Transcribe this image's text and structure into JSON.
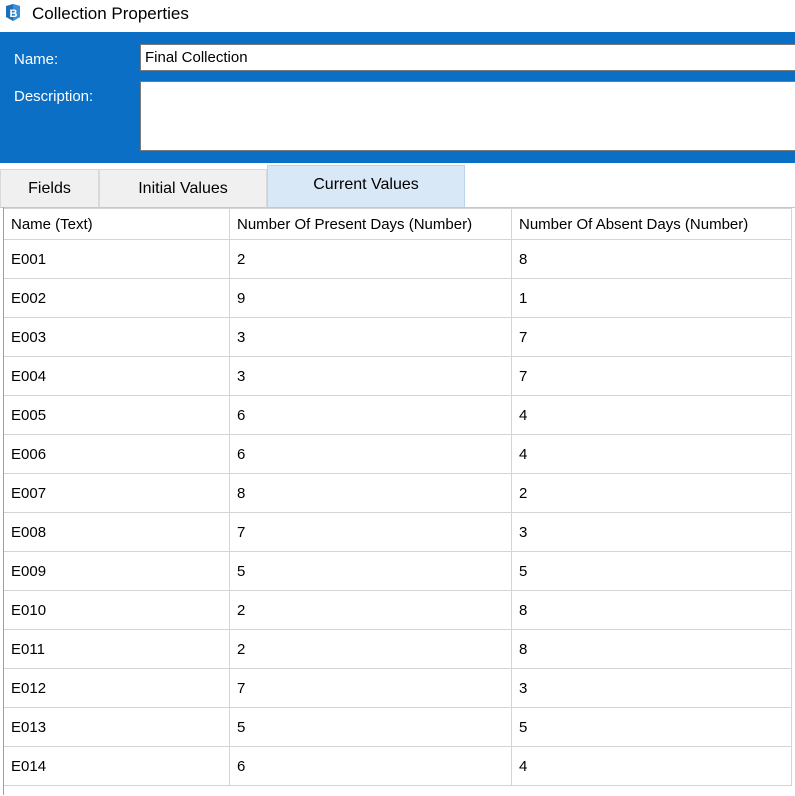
{
  "window": {
    "title": "Collection Properties",
    "icon": "blueprism-icon",
    "accent_color": "#0b6fc6"
  },
  "form": {
    "name_label": "Name:",
    "name_value": "Final Collection",
    "description_label": "Description:",
    "description_value": ""
  },
  "tabs": [
    {
      "label": "Fields",
      "active": false
    },
    {
      "label": "Initial Values",
      "active": false
    },
    {
      "label": "Current Values",
      "active": true
    }
  ],
  "grid": {
    "columns": [
      "Name  (Text)",
      "Number Of Present Days  (Number)",
      "Number Of Absent Days  (Number)"
    ],
    "rows": [
      [
        "E001",
        "2",
        "8"
      ],
      [
        "E002",
        "9",
        "1"
      ],
      [
        "E003",
        "3",
        "7"
      ],
      [
        "E004",
        "3",
        "7"
      ],
      [
        "E005",
        "6",
        "4"
      ],
      [
        "E006",
        "6",
        "4"
      ],
      [
        "E007",
        "8",
        "2"
      ],
      [
        "E008",
        "7",
        "3"
      ],
      [
        "E009",
        "5",
        "5"
      ],
      [
        "E010",
        "2",
        "8"
      ],
      [
        "E011",
        "2",
        "8"
      ],
      [
        "E012",
        "7",
        "3"
      ],
      [
        "E013",
        "5",
        "5"
      ],
      [
        "E014",
        "6",
        "4"
      ]
    ]
  }
}
